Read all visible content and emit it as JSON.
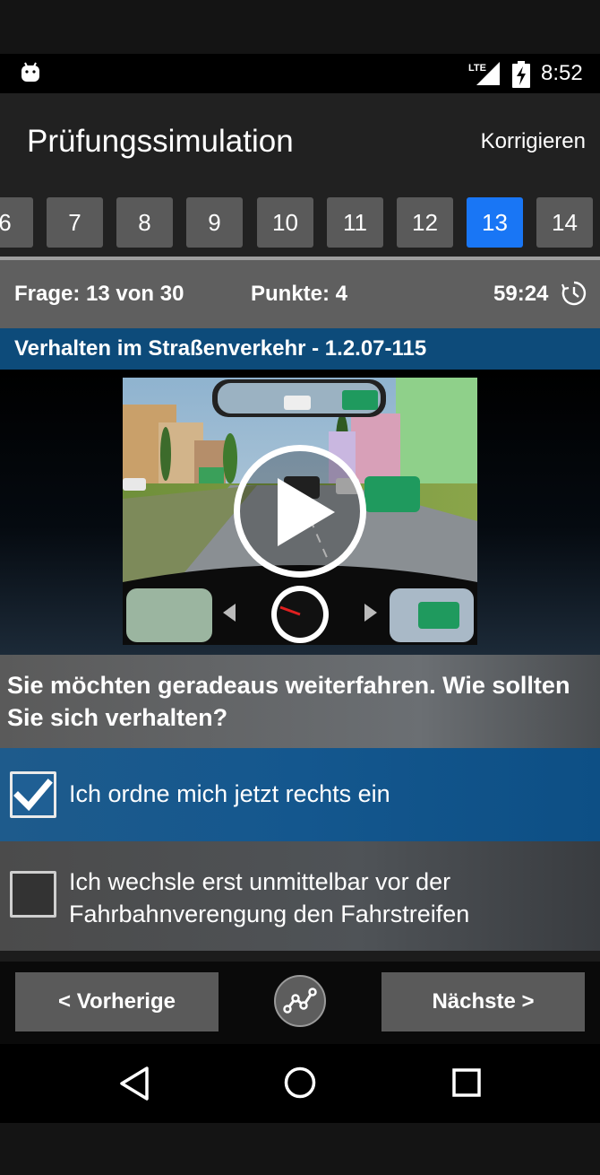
{
  "status_bar": {
    "network": "LTE",
    "time": "8:52"
  },
  "app_bar": {
    "title": "Prüfungssimulation",
    "action": "Korrigieren"
  },
  "question_nav": {
    "items": [
      "6",
      "7",
      "8",
      "9",
      "10",
      "11",
      "12",
      "13",
      "14"
    ],
    "active": "13"
  },
  "info_bar": {
    "question_counter": "Frage: 13 von 30",
    "points": "Punkte: 4",
    "timer": "59:24"
  },
  "category": "Verhalten im Straßenverkehr - 1.2.07-115",
  "question": "Sie möchten geradeaus weiterfahren. Wie sollten Sie sich verhalten?",
  "answers": [
    {
      "text": "Ich ordne mich jetzt rechts ein",
      "checked": true
    },
    {
      "text": "Ich wechsle erst unmittelbar vor der Fahrbahnverengung den Fahrstreifen",
      "checked": false
    }
  ],
  "bottom_bar": {
    "prev_label": "< Vorherige",
    "next_label": "Nächste >",
    "stats_icon": "line-chart-icon"
  },
  "system_nav": {
    "back_icon": "back-triangle-icon",
    "home_icon": "home-circle-icon",
    "recents_icon": "recents-square-icon"
  },
  "colors": {
    "accent": "#1976f5",
    "category_bar": "#0d4b7a",
    "selected_answer": "#1e5b8c"
  }
}
